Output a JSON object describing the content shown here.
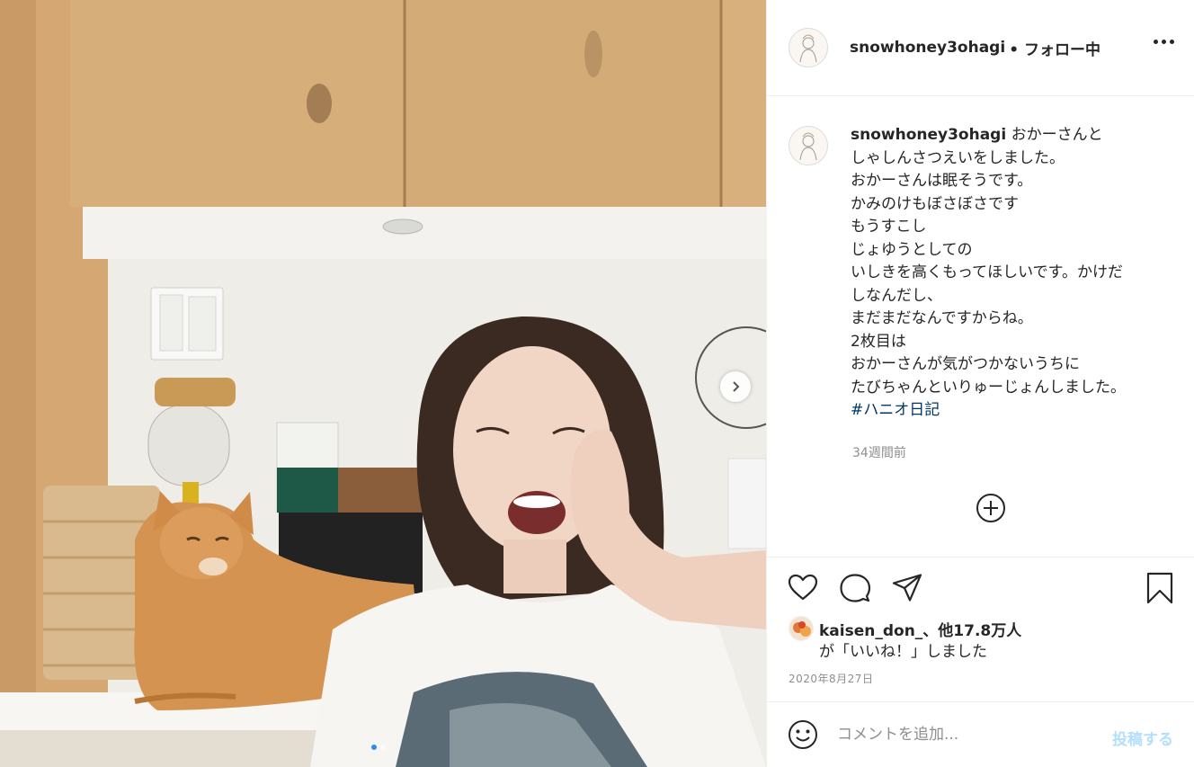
{
  "header": {
    "username": "snowhoney3ohagi",
    "follow_status": "• フォロー中",
    "more_icon": "more-options-icon"
  },
  "caption": {
    "username": "snowhoney3ohagi",
    "lines": [
      "おかーさんと",
      "しゃしんさつえいをしました。",
      "おかーさんは眠そうです。",
      "かみのけもぼさぼさです",
      "もうすこし",
      "じょゆうとしての",
      "いしきを高くもってほしいです。かけだ",
      "しなんだし、",
      "まだまだなんですからね。",
      "2枚目は",
      "おかーさんが気がつかないうちに",
      "たびちゃんといりゅーじょんしました。"
    ],
    "hashtag": "#ハニオ日記",
    "time_ago": "34週間前"
  },
  "actions": {
    "like_icon": "heart-icon",
    "comment_icon": "comment-icon",
    "share_icon": "share-icon",
    "save_icon": "bookmark-icon",
    "load_more_icon": "plus-circle-icon"
  },
  "likes": {
    "line1": "kaisen_don_、他17.8万人",
    "line2": "が「いいね！」しました"
  },
  "post_date": "2020年8月27日",
  "comment": {
    "placeholder": "コメントを追加...",
    "post_label": "投稿する"
  },
  "carousel": {
    "slide_count": 2,
    "current_slide": 1
  },
  "colors": {
    "link": "#00376b",
    "post_disabled": "#b2dffc",
    "carousel_active": "#2d8cf0"
  }
}
